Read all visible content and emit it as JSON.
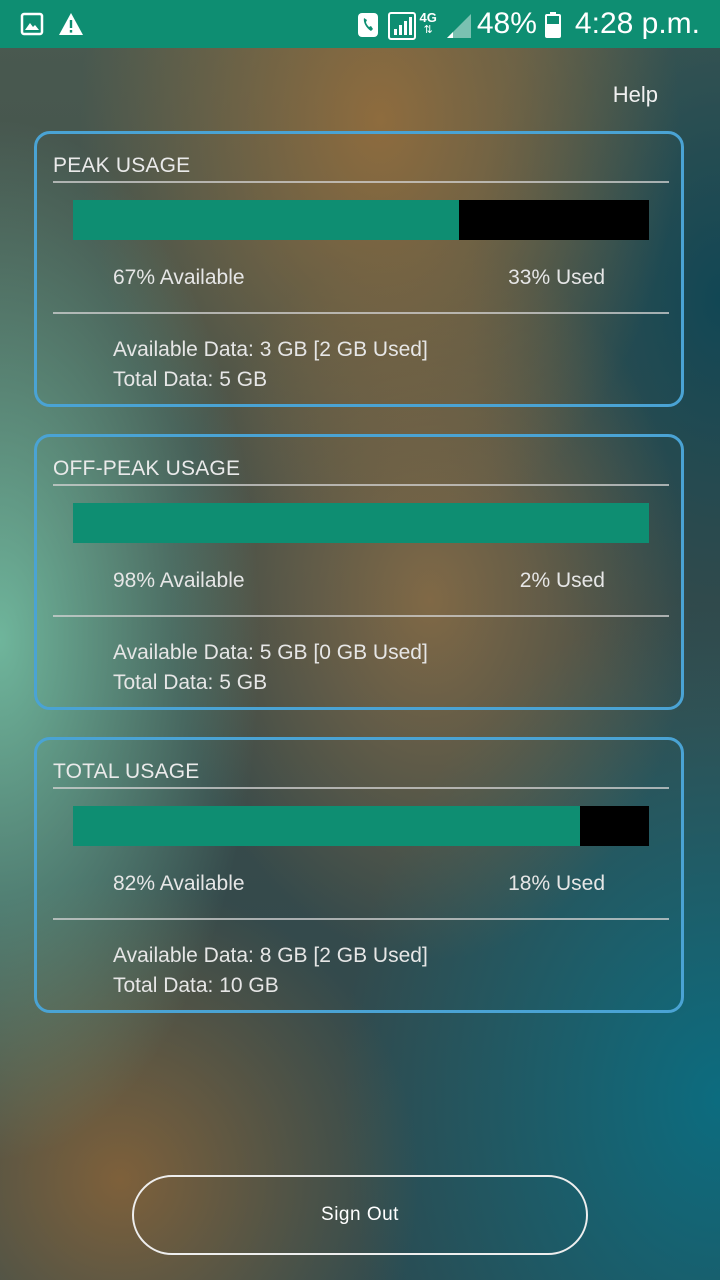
{
  "status_bar": {
    "battery": "48%",
    "time": "4:28 p.m.",
    "network": "4G",
    "icons": [
      "image-icon",
      "warning-icon",
      "call-icon",
      "signal-icon",
      "4g-icon",
      "signal-weak-icon",
      "battery-icon"
    ]
  },
  "header": {
    "help": "Help"
  },
  "cards": [
    {
      "title": "PEAK USAGE",
      "available_pct": 67,
      "available_text": "67% Available",
      "used_text": "33% Used",
      "available_data": "Available Data: 3 GB [2 GB Used]",
      "total_data": "Total Data: 5 GB"
    },
    {
      "title": "OFF-PEAK USAGE",
      "available_pct": 100,
      "available_text": "98% Available",
      "used_text": "2% Used",
      "available_data": "Available Data: 5 GB [0 GB Used]",
      "total_data": "Total Data: 5 GB"
    },
    {
      "title": "TOTAL USAGE",
      "available_pct": 88,
      "available_text": "82% Available",
      "used_text": "18% Used",
      "available_data": "Available Data: 8 GB [2 GB Used]",
      "total_data": "Total Data: 10 GB"
    }
  ],
  "actions": {
    "sign_out": "Sign Out"
  },
  "colors": {
    "accent": "#0e8e72",
    "card_border": "#4aa3d4",
    "bar_track": "#000000"
  }
}
